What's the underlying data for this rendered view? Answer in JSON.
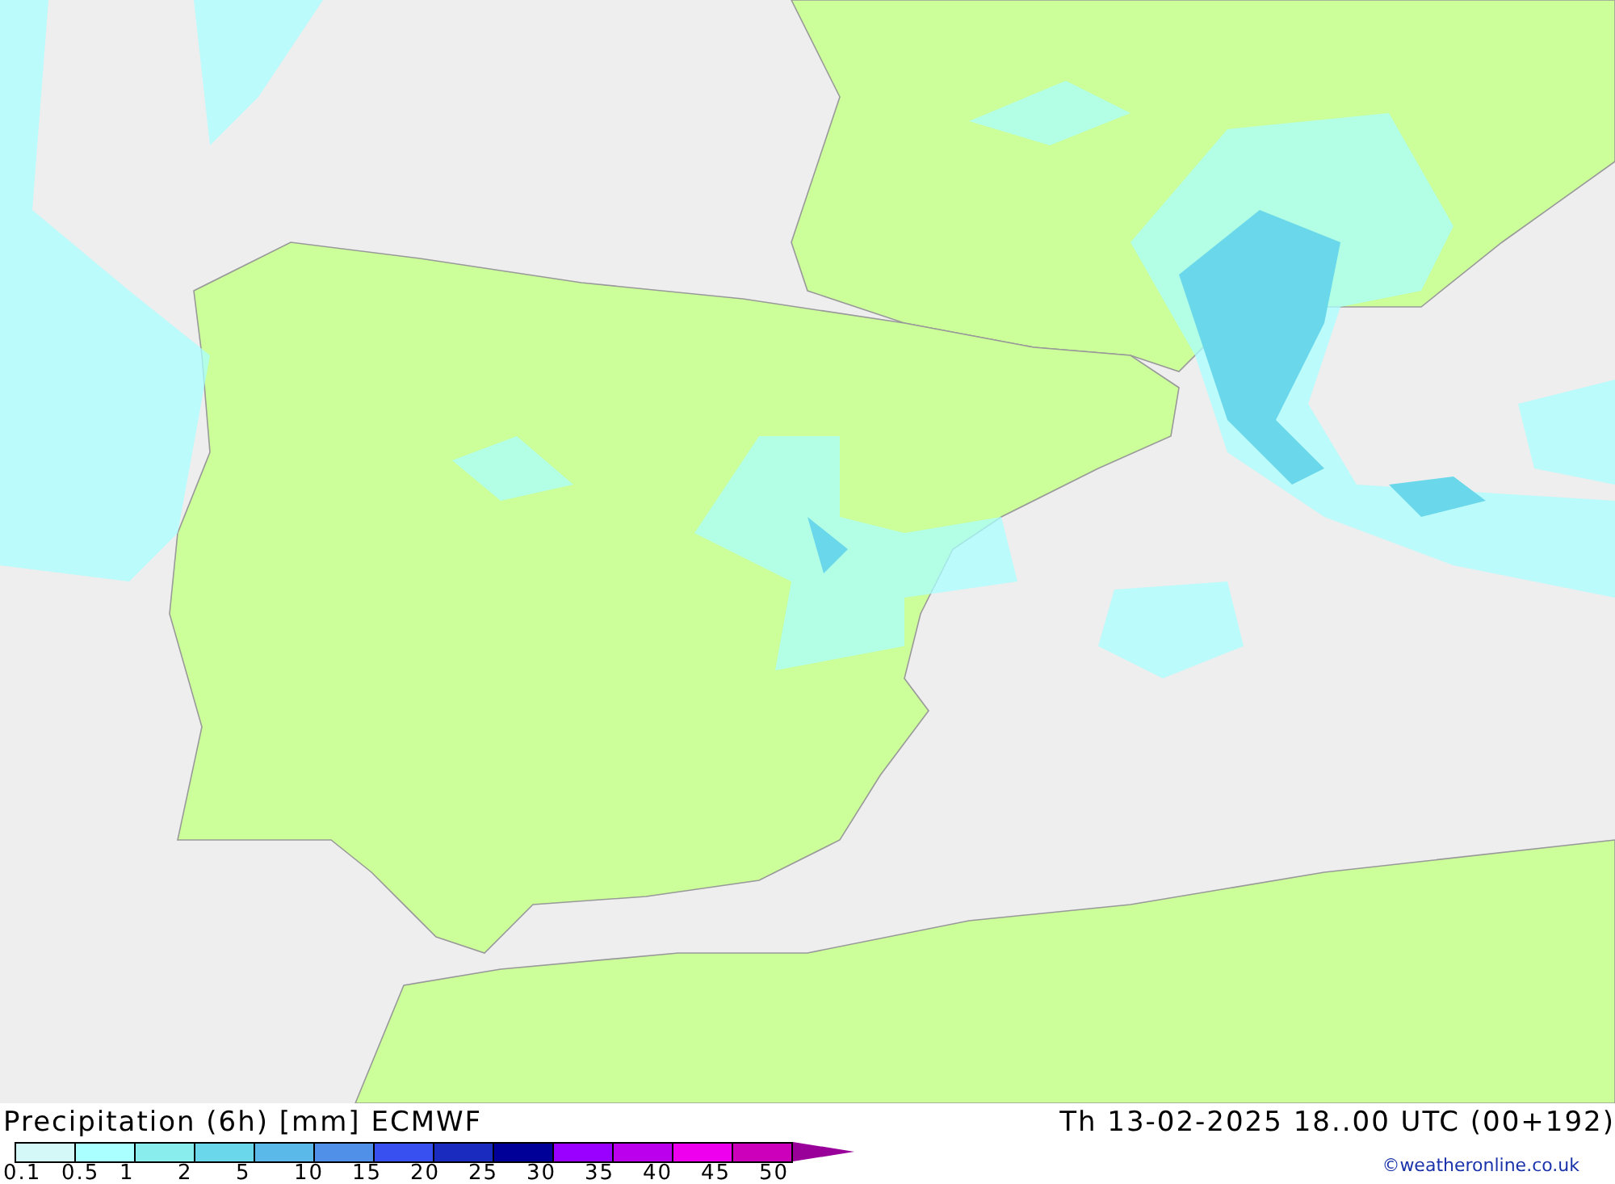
{
  "map": {
    "title": "Precipitation (6h) [mm] ECMWF",
    "valid_time": "Th 13-02-2025 18..00 UTC (00+192)"
  },
  "legend": {
    "swatches": [
      {
        "color": "#d4f7f7"
      },
      {
        "color": "#aaffff"
      },
      {
        "color": "#8aeded"
      },
      {
        "color": "#6ad8ea"
      },
      {
        "color": "#5ab9e8"
      },
      {
        "color": "#5090e8"
      },
      {
        "color": "#3850f0"
      },
      {
        "color": "#1a2cbf"
      },
      {
        "color": "#000099"
      },
      {
        "color": "#9900ff"
      },
      {
        "color": "#bb00ee"
      },
      {
        "color": "#ee00ee"
      },
      {
        "color": "#cc00bb"
      }
    ],
    "overflow": {
      "kind": "arrow",
      "color": "#990099"
    },
    "labels": [
      "0.1",
      "0.5",
      "1",
      "2",
      "5",
      "10",
      "15",
      "20",
      "25",
      "30",
      "35",
      "40",
      "45",
      "50"
    ]
  },
  "credit": "©weatheronline.co.uk"
}
